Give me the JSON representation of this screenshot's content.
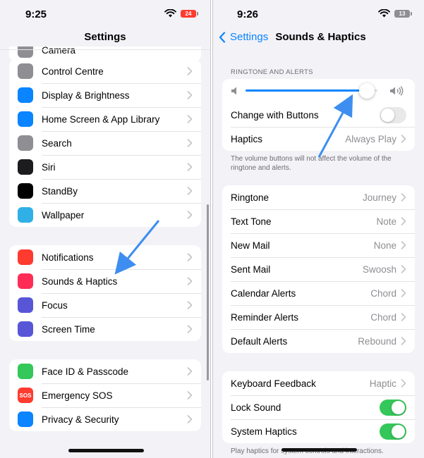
{
  "left": {
    "status_time": "9:25",
    "battery": "24",
    "nav_title": "Settings",
    "partial_item": "Camera",
    "groups": [
      [
        {
          "label": "Control Centre",
          "icon": "control-centre-icon",
          "color": "#8e8e93"
        },
        {
          "label": "Display & Brightness",
          "icon": "display-brightness-icon",
          "color": "#0a84ff"
        },
        {
          "label": "Home Screen & App Library",
          "icon": "home-screen-icon",
          "color": "#0a84ff"
        },
        {
          "label": "Search",
          "icon": "search-icon",
          "color": "#8e8e93"
        },
        {
          "label": "Siri",
          "icon": "siri-icon",
          "color": "#1c1c1e"
        },
        {
          "label": "StandBy",
          "icon": "standby-icon",
          "color": "#000000"
        },
        {
          "label": "Wallpaper",
          "icon": "wallpaper-icon",
          "color": "#30b0e6"
        }
      ],
      [
        {
          "label": "Notifications",
          "icon": "notifications-icon",
          "color": "#ff3b30"
        },
        {
          "label": "Sounds & Haptics",
          "icon": "sounds-icon",
          "color": "#ff2d55"
        },
        {
          "label": "Focus",
          "icon": "focus-icon",
          "color": "#5856d6"
        },
        {
          "label": "Screen Time",
          "icon": "screen-time-icon",
          "color": "#5856d6"
        }
      ],
      [
        {
          "label": "Face ID & Passcode",
          "icon": "face-id-icon",
          "color": "#34c759"
        },
        {
          "label": "Emergency SOS",
          "icon": "sos-icon",
          "color": "#ff3b30",
          "text": "SOS"
        },
        {
          "label": "Privacy & Security",
          "icon": "privacy-hand-icon",
          "color": "#0a84ff"
        }
      ]
    ]
  },
  "right": {
    "status_time": "9:26",
    "battery": "13",
    "back_label": "Settings",
    "nav_title": "Sounds & Haptics",
    "ringtone_header": "RINGTONE AND ALERTS",
    "volume_level": 0.92,
    "change_with_buttons": {
      "label": "Change with Buttons",
      "on": false
    },
    "haptics": {
      "label": "Haptics",
      "value": "Always Play"
    },
    "ringtone_footnote": "The volume buttons will not affect the volume of the ringtone and alerts.",
    "sounds": [
      {
        "label": "Ringtone",
        "value": "Journey"
      },
      {
        "label": "Text Tone",
        "value": "Note"
      },
      {
        "label": "New Mail",
        "value": "None"
      },
      {
        "label": "Sent Mail",
        "value": "Swoosh"
      },
      {
        "label": "Calendar Alerts",
        "value": "Chord"
      },
      {
        "label": "Reminder Alerts",
        "value": "Chord"
      },
      {
        "label": "Default Alerts",
        "value": "Rebound"
      }
    ],
    "keyboard_feedback": {
      "label": "Keyboard Feedback",
      "value": "Haptic"
    },
    "lock_sound": {
      "label": "Lock Sound",
      "on": true
    },
    "system_haptics": {
      "label": "System Haptics",
      "on": true
    },
    "system_footnote": "Play haptics for system controls and interactions."
  },
  "accent_color": "#0a84ff",
  "annotation_color": "#3d8ef0"
}
